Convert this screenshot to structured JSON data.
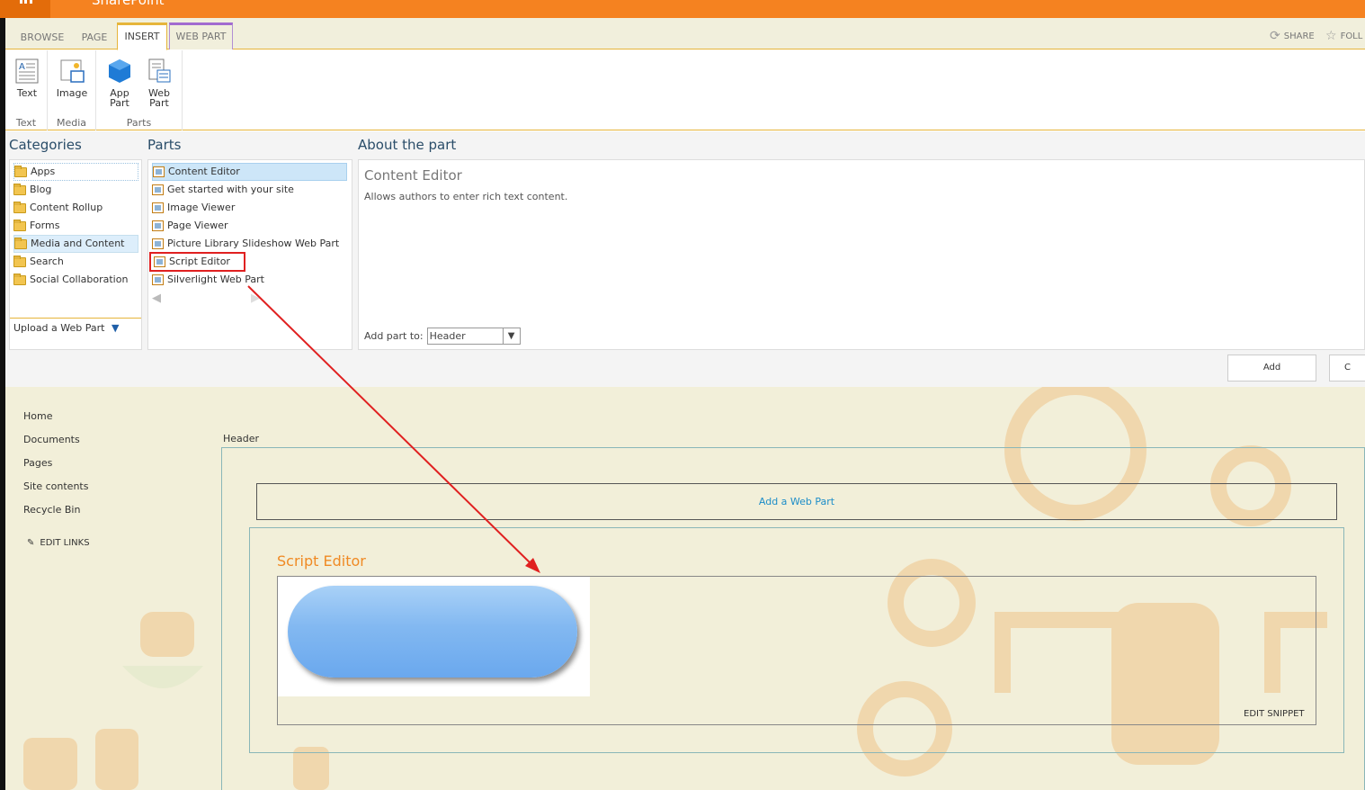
{
  "topbar": {
    "brand": "SharePoint"
  },
  "tabs": [
    {
      "label": "BROWSE"
    },
    {
      "label": "PAGE"
    },
    {
      "label": "INSERT"
    },
    {
      "label": "WEB PART"
    }
  ],
  "tab_actions": {
    "share": "SHARE",
    "follow": "FOLL"
  },
  "ribbon": {
    "text_group": {
      "button": "Text",
      "label": "Text"
    },
    "media_group": {
      "button": "Image",
      "label": "Media"
    },
    "parts_group": {
      "app_part_1": "App",
      "app_part_2": "Part",
      "web_part_1": "Web",
      "web_part_2": "Part",
      "label": "Parts"
    }
  },
  "picker": {
    "categories_header": "Categories",
    "parts_header": "Parts",
    "about_header": "About the part",
    "categories": [
      "Apps",
      "Blog",
      "Content Rollup",
      "Forms",
      "Media and Content",
      "Search",
      "Social Collaboration"
    ],
    "upload": "Upload a Web Part",
    "parts": [
      "Content Editor",
      "Get started with your site",
      "Image Viewer",
      "Page Viewer",
      "Picture Library Slideshow Web Part",
      "Script Editor",
      "Silverlight Web Part"
    ],
    "about_title": "Content Editor",
    "about_desc": "Allows authors to enter rich text content.",
    "add_part_to_label": "Add part to:",
    "add_part_to_value": "Header",
    "add_button": "Add",
    "cancel_button": "C"
  },
  "nav": {
    "items": [
      "Home",
      "Documents",
      "Pages",
      "Site contents",
      "Recycle Bin"
    ],
    "edit_links": "EDIT LINKS"
  },
  "page": {
    "zone_label": "Header",
    "add_web_part": "Add a Web Part",
    "webpart_title": "Script Editor",
    "edit_snippet": "EDIT SNIPPET"
  },
  "colors": {
    "suite_bar": "#f58220",
    "accent": "#e6b53b",
    "link": "#1c8dc8",
    "webpart_title": "#f08a24",
    "annotation": "#e02020"
  }
}
